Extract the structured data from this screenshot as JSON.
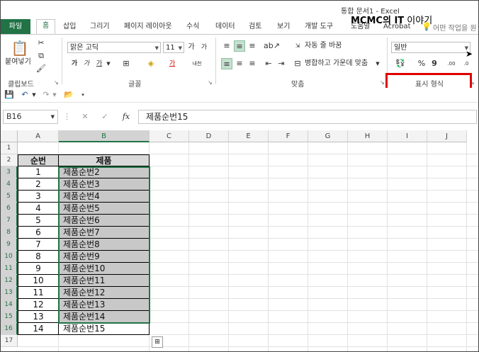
{
  "window": {
    "title": "통합 문서1  -  Excel"
  },
  "watermark": {
    "a": "MCMC의 ",
    "b": "IT",
    "c": " 이야기"
  },
  "tabs": [
    "파일",
    "홈",
    "삽입",
    "그리기",
    "페이지 레이아웃",
    "수식",
    "데이터",
    "검토",
    "보기",
    "개발 도구",
    "도움말",
    "Acrobat"
  ],
  "tell_me": "어떤 작업을 원",
  "clipboard": {
    "paste_label": "붙여넣기",
    "group": "클립보드"
  },
  "font": {
    "name": "맑은 고딕",
    "size": "11",
    "group": "글꼴",
    "bold": "가",
    "italic": "가",
    "underline": "가",
    "font_color": "가",
    "phonetic": "내천"
  },
  "alignment": {
    "wrap": "자동 줄 바꿈",
    "merge": "병합하고 가운데 맞춤",
    "group": "맞춤"
  },
  "number": {
    "format": "일반",
    "group": "표시 형식",
    "percent": "%",
    "comma": "9",
    "inc_dec": ".00",
    "dec_dec": ".0"
  },
  "formula_bar": {
    "name_box": "B16",
    "fx": "fx",
    "cancel": "✕",
    "enter": "✓",
    "content": "제품순번15"
  },
  "columns": [
    "A",
    "B",
    "C",
    "D",
    "E",
    "F",
    "G",
    "H",
    "I",
    "J"
  ],
  "rows": [
    "1",
    "2",
    "3",
    "4",
    "5",
    "6",
    "7",
    "8",
    "9",
    "10",
    "11",
    "12",
    "13",
    "14",
    "15",
    "16",
    "17"
  ],
  "table": {
    "header": [
      "순번",
      "제품"
    ],
    "rows": [
      [
        "1",
        "제품순번2"
      ],
      [
        "2",
        "제품순번3"
      ],
      [
        "3",
        "제품순번4"
      ],
      [
        "4",
        "제품순번5"
      ],
      [
        "5",
        "제품순번6"
      ],
      [
        "6",
        "제품순번7"
      ],
      [
        "7",
        "제품순번8"
      ],
      [
        "8",
        "제품순번9"
      ],
      [
        "9",
        "제품순번10"
      ],
      [
        "10",
        "제품순번11"
      ],
      [
        "11",
        "제품순번12"
      ],
      [
        "12",
        "제품순번13"
      ],
      [
        "13",
        "제품순번14"
      ],
      [
        "14",
        "제품순번15"
      ]
    ]
  },
  "colors": {
    "excel_green": "#217346",
    "highlight_red": "#e00000",
    "selected_gray": "#c8c8c8",
    "header_gray": "#d9d9d9"
  }
}
